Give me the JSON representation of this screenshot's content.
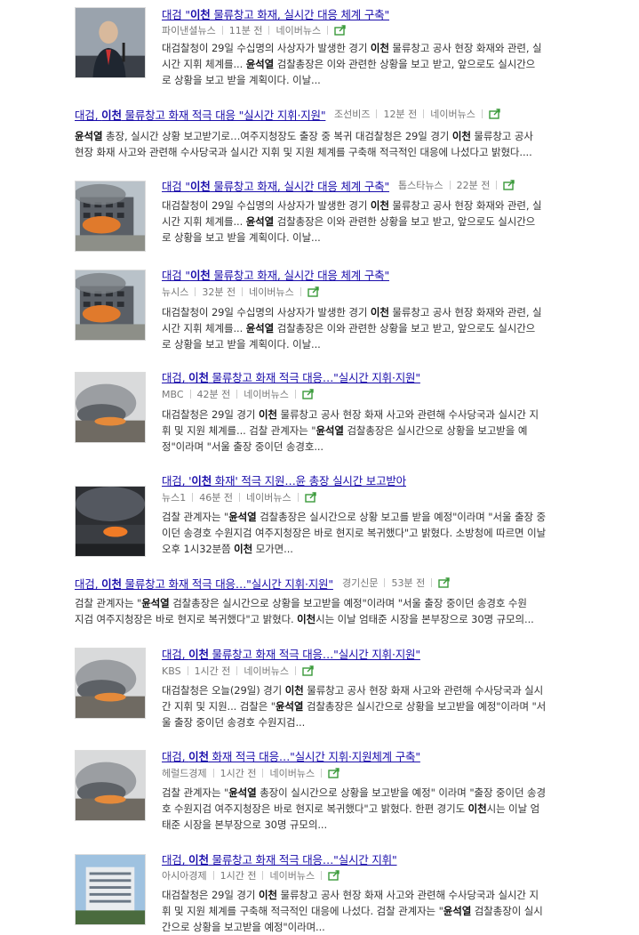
{
  "items": [
    {
      "title_pre": "대검 \"",
      "title_kw": "이천",
      "title_post": " 물류창고 화재, 실시간 대응 체계 구축\"",
      "source": "파이낸셜뉴스",
      "time": "11분 전",
      "portal": "네이버뉴스",
      "thumb": "person-photo",
      "desc_lines": [
        [
          "대검찰청이 29일 수십명의 사상자가 발생한 경기 ",
          {
            "kw": "이천"
          },
          " 물류창고 공사 현장 화재와 관련, 실"
        ],
        [
          "시간 지휘 체계를... ",
          {
            "kw": "윤석열"
          },
          " 검찰총장은 이와 관련한 상황을 보고 받고, 앞으로도 실시간으"
        ],
        [
          "로 상황을 보고 받을 계획이다. 이날..."
        ]
      ]
    },
    {
      "title_pre": "대검, ",
      "title_kw": "이천",
      "title_post": " 물류창고 화재 적극 대응 \"실시간 지휘·지원\"",
      "source": "조선비즈",
      "time": "12분 전",
      "portal": "네이버뉴스",
      "thumb": "",
      "desc_lines": [
        [
          {
            "kw": "윤석열"
          },
          " 총장, 실시간 상황 보고받기로…여주지청장도 출장 중 복귀 대검찰청은 29일 경기 ",
          {
            "kw": "이천"
          },
          " 물류창고 공사"
        ],
        [
          "현장 화재 사고와 관련해 수사당국과 실시간 지휘 및 지원 체계를 구축해 적극적인 대응에 나섰다고 밝혔다...."
        ]
      ]
    },
    {
      "title_pre": "대검 \"",
      "title_kw": "이천",
      "title_post": " 물류창고 화재, 실시간 대응 체계 구축\"",
      "source": "톱스타뉴스",
      "time": "22분 전",
      "portal": "",
      "thumb": "building-fire-photo",
      "desc_lines": [
        [
          "대검찰청이 29일 수십명의 사상자가 발생한 경기 ",
          {
            "kw": "이천"
          },
          " 물류창고 공사 현장 화재와 관련, 실"
        ],
        [
          "시간 지휘 체계를... ",
          {
            "kw": "윤석열"
          },
          " 검찰총장은 이와 관련한 상황을 보고 받고, 앞으로도 실시간으"
        ],
        [
          "로 상황을 보고 받을 계획이다. 이날..."
        ]
      ]
    },
    {
      "title_pre": "대검 \"",
      "title_kw": "이천",
      "title_post": " 물류창고 화재, 실시간 대응 체계 구축\"",
      "source": "뉴시스",
      "time": "32분 전",
      "portal": "네이버뉴스",
      "thumb": "building-fire-photo",
      "desc_lines": [
        [
          "대검찰청이 29일 수십명의 사상자가 발생한 경기 ",
          {
            "kw": "이천"
          },
          " 물류창고 공사 현장 화재와 관련, 실"
        ],
        [
          "시간 지휘 체계를... ",
          {
            "kw": "윤석열"
          },
          " 검찰총장은 이와 관련한 상황을 보고 받고, 앞으로도 실시간으"
        ],
        [
          "로 상황을 보고 받을 계획이다. 이날..."
        ]
      ]
    },
    {
      "title_pre": "대검, ",
      "title_kw": "이천",
      "title_post": " 물류창고 화재 적극 대응…\"실시간 지휘·지원\"",
      "source": "MBC",
      "time": "42분 전",
      "portal": "네이버뉴스",
      "thumb": "smoke-photo",
      "desc_lines": [
        [
          "대검찰청은 29일 경기 ",
          {
            "kw": "이천"
          },
          " 물류창고 공사 현장 화재 사고와 관련해 수사당국과 실시간 지"
        ],
        [
          "휘 및 지원 체계를... 검찰 관계자는 \"",
          {
            "kw": "윤석열"
          },
          " 검찰총장은 실시간으로 상황을 보고받을 예"
        ],
        [
          "정\"이라며 \"서울 출장 중이던 송경호..."
        ]
      ]
    },
    {
      "title_pre": "대검, '",
      "title_kw": "이천",
      "title_post": " 화재' 적극 지원…윤 총장 실시간 보고받아",
      "source": "뉴스1",
      "time": "46분 전",
      "portal": "네이버뉴스",
      "thumb": "dark-smoke-photo",
      "desc_lines": [
        [
          "검찰 관계자는 \"",
          {
            "kw": "윤석열"
          },
          " 검찰총장은 실시간으로 상황 보고를 받을 예정\"이라며 \"서울 출장 중"
        ],
        [
          "이던 송경호 수원지검 여주지청장은 바로 현지로 복귀했다\"고 밝혔다. 소방청에 따르면 이날"
        ],
        [
          "오후 1시32분쯤 ",
          {
            "kw": "이천"
          },
          " 모가면..."
        ]
      ]
    },
    {
      "title_pre": "대검, ",
      "title_kw": "이천",
      "title_post": " 물류창고 화재 적극 대응…\"실시간 지휘·지원\"",
      "source": "경기신문",
      "time": "53분 전",
      "portal": "",
      "thumb": "",
      "desc_lines": [
        [
          "검찰 관계자는 \"",
          {
            "kw": "윤석열"
          },
          " 검찰총장은 실시간으로 상황을 보고받을 예정\"이라며 \"서울 출장 중이던 송경호 수원"
        ],
        [
          "지검 여주지청장은 바로 현지로 복귀했다\"고 밝혔다. ",
          {
            "kw": "이천"
          },
          "시는 이날 엄태준 시장을 본부장으로 30명 규모의..."
        ]
      ]
    },
    {
      "title_pre": "대검, ",
      "title_kw": "이천",
      "title_post": " 물류창고 화재 적극 대응…\"실시간 지휘·지원\"",
      "source": "KBS",
      "time": "1시간 전",
      "portal": "네이버뉴스",
      "thumb": "smoke-photo",
      "desc_lines": [
        [
          "대검찰청은 오늘(29일) 경기 ",
          {
            "kw": "이천"
          },
          " 물류창고 공사 현장 화재 사고와 관련해 수사당국과 실시"
        ],
        [
          "간 지휘 및 지원... 검찰은 \"",
          {
            "kw": "윤석열"
          },
          " 검찰총장은 실시간으로 상황을 보고받을 예정\"이라며 \"서"
        ],
        [
          "울 출장 중이던 송경호 수원지검..."
        ]
      ]
    },
    {
      "title_pre": "대검, ",
      "title_kw": "이천",
      "title_post": " 화재 적극 대응…\"실시간 지휘·지원체계 구축\"",
      "source": "헤럴드경제",
      "time": "1시간 전",
      "portal": "네이버뉴스",
      "thumb": "smoke-photo",
      "desc_lines": [
        [
          "검찰 관계자는 \"",
          {
            "kw": "윤석열"
          },
          " 총장이 실시간으로 상황을 보고받을 예정\" 이라며 \"출장 중이던 송경"
        ],
        [
          "호 수원지검 여주지청장은 바로 현지로 복귀했다\"고 밝혔다. 한편 경기도 ",
          {
            "kw": "이천"
          },
          "시는 이날 엄"
        ],
        [
          "태준 시장을 본부장으로 30명 규모의..."
        ]
      ]
    },
    {
      "title_pre": "대검, ",
      "title_kw": "이천",
      "title_post": " 물류창고 화재 적극 대응…\"실시간 지휘\"",
      "source": "아시아경제",
      "time": "1시간 전",
      "portal": "네이버뉴스",
      "thumb": "office-building-photo",
      "desc_lines": [
        [
          "대검찰청은 29일 경기 ",
          {
            "kw": "이천"
          },
          " 물류창고 공사 현장 화재 사고와 관련해 수사당국과 실시간 지"
        ],
        [
          "휘 및 지원 체계를 구축해 적극적인 대응에 나섰다. 검찰 관계자는 \"",
          {
            "kw": "윤석열"
          },
          " 검찰총장이 실시"
        ],
        [
          "간으로 상황을 보고받을 예정\"이라며..."
        ]
      ]
    }
  ]
}
